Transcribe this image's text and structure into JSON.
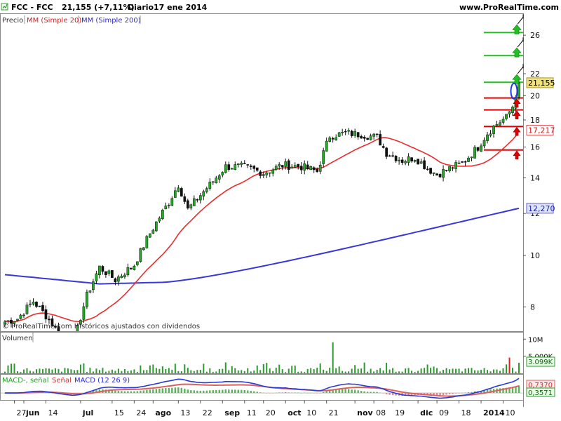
{
  "header": {
    "symbol": "FCC - FCC",
    "price_change": "21,155 (+7,11%)",
    "period": "Diario",
    "date": "17 ene 2014",
    "website": "www.ProRealTime.com"
  },
  "legend": {
    "price": "Precio",
    "ma20": "MM (Simple 20)",
    "ma200": "MM (Simple 200)",
    "copyright": "© ProRealTime.com  Históricos ajustados con dividendos"
  },
  "volume_panel": {
    "label": "Volumen",
    "ticks": [
      {
        "label": "10M",
        "v": 10000000
      },
      {
        "label": "5.000K",
        "v": 5000000
      }
    ],
    "last_label": "3.099K"
  },
  "macd_panel": {
    "label_a": "MACD-, señal",
    "label_b": "Señal",
    "label_c": "MACD (12 26 9)",
    "macd_label": "0,7370",
    "signal_label": "0,3571"
  },
  "price_badges": {
    "last": "21,155",
    "ma20": "17,217",
    "ma200": "12,270"
  },
  "colors": {
    "up": "#22aa22",
    "down": "#111111",
    "ma20": "#e82c2c",
    "ma200": "#3838d8",
    "volume": "#2c9a2c",
    "volume_spike": "#dd2222",
    "macd": "#2a3ad8",
    "signal": "#dd6060",
    "hist": "#5ab55a",
    "level_green": "#22c022",
    "level_red": "#e00000",
    "badge_last": "#f0e080",
    "badge_ma200": "#dde4ff"
  },
  "chart_data": {
    "type": "candlestick",
    "title": "FCC - FCC",
    "y_scale": "log",
    "ylim": [
      7.2,
      28.5
    ],
    "y_ticks": [
      {
        "label": "26",
        "v": 26
      },
      {
        "label": "22",
        "v": 22
      },
      {
        "label": "20",
        "v": 20
      },
      {
        "label": "18",
        "v": 18
      },
      {
        "label": "16",
        "v": 16
      },
      {
        "label": "14",
        "v": 14
      },
      {
        "label": "12",
        "v": 12
      },
      {
        "label": "10",
        "v": 10
      },
      {
        "label": "8",
        "v": 8
      }
    ],
    "x_ticks": [
      {
        "label": "27",
        "i": 3
      },
      {
        "label": "jun",
        "i": 6
      },
      {
        "label": "14",
        "i": 13
      },
      {
        "label": "jul",
        "i": 24
      },
      {
        "label": "15",
        "i": 34
      },
      {
        "label": "24",
        "i": 41
      },
      {
        "label": "ago",
        "i": 47
      },
      {
        "label": "13",
        "i": 55
      },
      {
        "label": "22",
        "i": 62
      },
      {
        "label": "sep",
        "i": 69
      },
      {
        "label": "11",
        "i": 76
      },
      {
        "label": "20",
        "i": 82
      },
      {
        "label": "oct",
        "i": 89
      },
      {
        "label": "10",
        "i": 95
      },
      {
        "label": "21",
        "i": 102
      },
      {
        "label": "nov",
        "i": 111
      },
      {
        "label": "08",
        "i": 117
      },
      {
        "label": "19",
        "i": 123
      },
      {
        "label": "dic",
        "i": 131
      },
      {
        "label": "09",
        "i": 137
      },
      {
        "label": "18",
        "i": 144
      },
      {
        "label": "2014",
        "i": 151
      },
      {
        "label": "10",
        "i": 158
      }
    ],
    "key_prices": [
      {
        "date": "27 may 2013",
        "close": 7.5
      },
      {
        "date": "14 jun 2013",
        "close": 7.0
      },
      {
        "date": "15 jul 2013",
        "close": 9.4
      },
      {
        "date": "13 ago 2013",
        "close": 13.5
      },
      {
        "date": "sep 2013",
        "close": 14.6
      },
      {
        "date": "21 oct 2013",
        "close": 17.2
      },
      {
        "date": "19 nov 2013",
        "close": 15.0
      },
      {
        "date": "09 dic 2013",
        "close": 14.3
      },
      {
        "date": "17 ene 2014",
        "close": 21.155
      }
    ],
    "last_close": 21.155,
    "ma20_last": 17.217,
    "ma200_last": 12.27,
    "support_resistance": [
      {
        "price": 26.3,
        "color": "green"
      },
      {
        "price": 23.8,
        "color": "green"
      },
      {
        "price": 21.2,
        "color": "green"
      },
      {
        "price": 19.8,
        "color": "red"
      },
      {
        "price": 18.8,
        "color": "red"
      },
      {
        "price": 17.5,
        "color": "red"
      },
      {
        "price": 15.8,
        "color": "red"
      }
    ],
    "volume_last": 3099000,
    "volume_ylim": [
      0,
      11500000
    ],
    "macd_last": 0.737,
    "signal_last": 0.3571,
    "macd_ylim": [
      -0.35,
      0.85
    ]
  }
}
